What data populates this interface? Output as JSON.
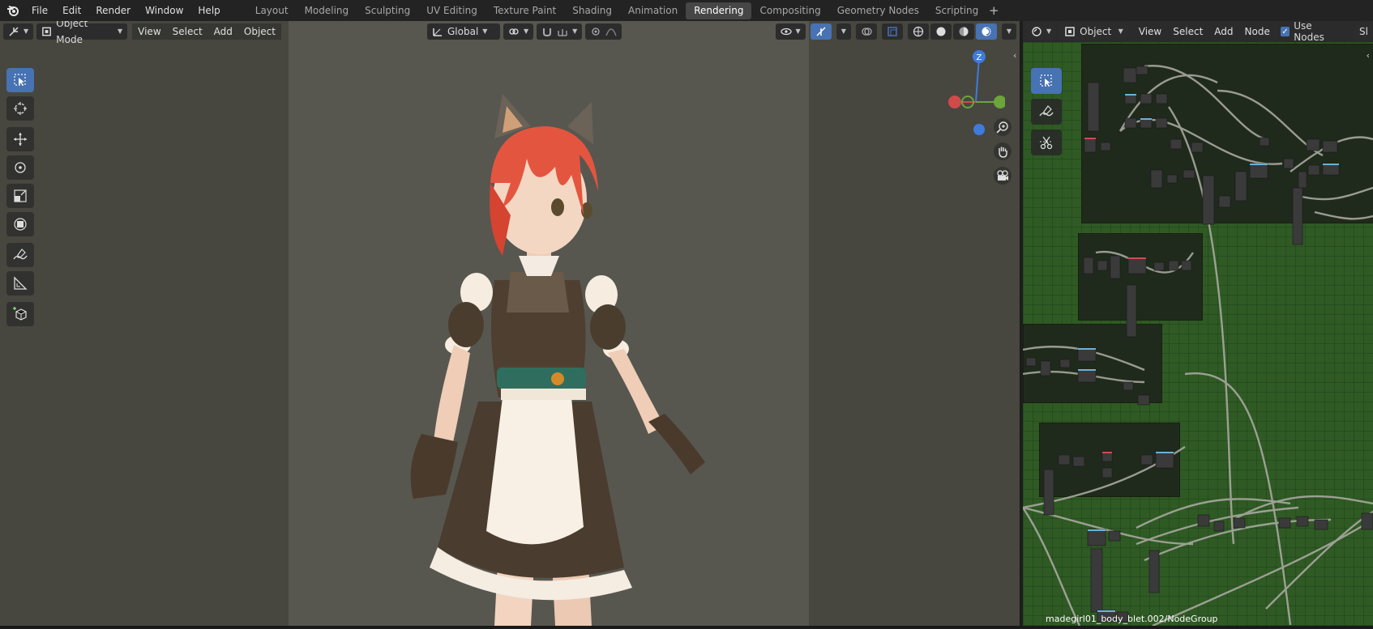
{
  "topbar": {
    "menus": [
      "File",
      "Edit",
      "Render",
      "Window",
      "Help"
    ],
    "workspaces": [
      "Layout",
      "Modeling",
      "Sculpting",
      "UV Editing",
      "Texture Paint",
      "Shading",
      "Animation",
      "Rendering",
      "Compositing",
      "Geometry Nodes",
      "Scripting"
    ],
    "active_workspace": "Rendering",
    "add_workspace": "+"
  },
  "viewport": {
    "mode": "Object Mode",
    "menus": [
      "View",
      "Select",
      "Add",
      "Object"
    ],
    "transform_orientation": "Global",
    "gizmo_axis_z": "Z",
    "colors": {
      "bg": "#474740",
      "camera_area": "#575750",
      "accent": "#4772b3"
    }
  },
  "node_editor": {
    "type": "Object",
    "menus": [
      "View",
      "Select",
      "Add",
      "Node"
    ],
    "use_nodes_label": "Use Nodes",
    "use_nodes": true,
    "overflow_label": "Sl",
    "group_path": "madegirl01_body_blet.002/NodeGroup"
  },
  "icons": [
    "blender-logo",
    "editor-type-icon",
    "object-mode-icon",
    "transform-orientation-icon",
    "pivot-icon",
    "snap-icon",
    "proportional-icon",
    "visibility-icon",
    "gizmo-icon",
    "overlay-icon",
    "xray-icon",
    "wireframe-icon",
    "solid-icon",
    "material-icon",
    "rendered-icon",
    "select-box-icon",
    "cursor-icon",
    "move-icon",
    "rotate-icon",
    "scale-icon",
    "transform-icon",
    "annotate-icon",
    "measure-icon",
    "add-cube-icon",
    "zoom-icon",
    "hand-icon",
    "camera-icon",
    "annotate-pen-icon",
    "cut-links-icon"
  ]
}
